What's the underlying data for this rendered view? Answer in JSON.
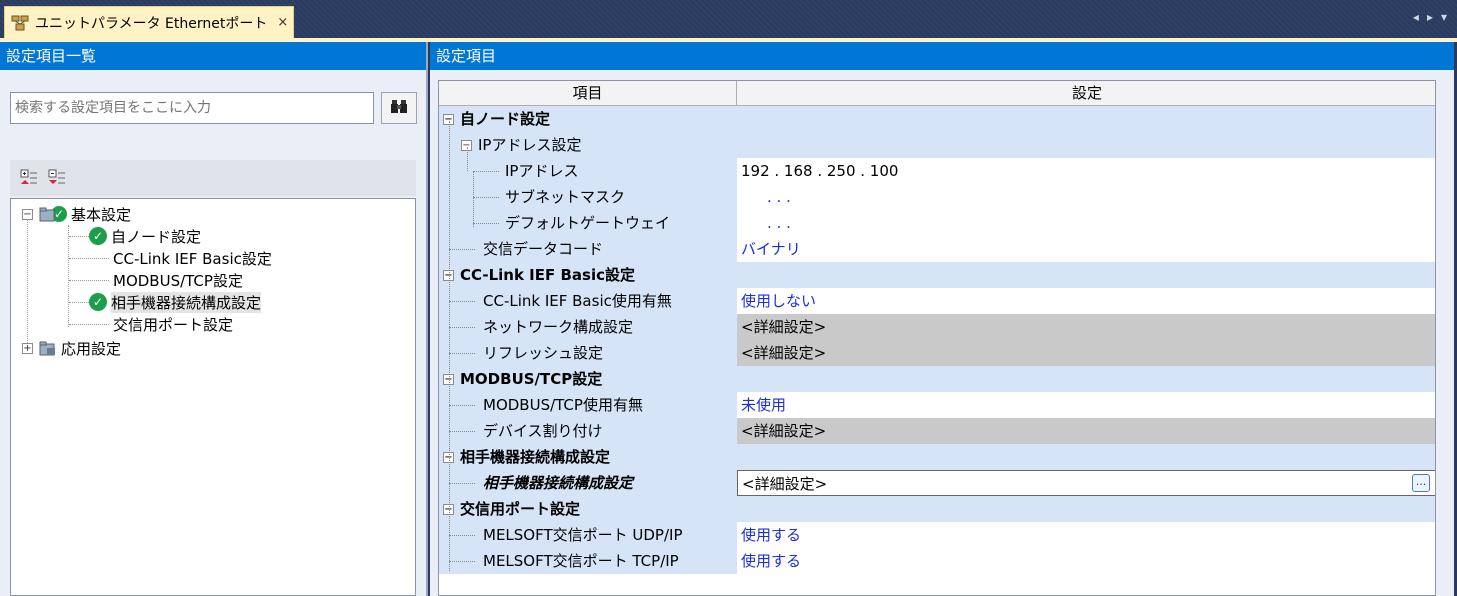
{
  "tab": {
    "title": "ユニットパラメータ Ethernetポート",
    "close": "×"
  },
  "tab_nav": {
    "prev": "◂",
    "next": "▸",
    "menu": "▾"
  },
  "left_panel": {
    "header": "設定項目一覧",
    "search_placeholder": "検索する設定項目をここに入力",
    "tree": [
      {
        "label": "基本設定",
        "expander": "−"
      },
      {
        "label": "自ノード設定"
      },
      {
        "label": "CC-Link IEF Basic設定"
      },
      {
        "label": "MODBUS/TCP設定"
      },
      {
        "label": "相手機器接続構成設定"
      },
      {
        "label": "交信用ポート設定"
      },
      {
        "label": "応用設定",
        "expander": "+"
      }
    ]
  },
  "right_panel": {
    "header": "設定項目",
    "col_item": "項目",
    "col_setting": "設定",
    "rows": [
      {
        "item": "自ノード設定",
        "value": ""
      },
      {
        "item": "IPアドレス設定",
        "value": ""
      },
      {
        "item": "IPアドレス",
        "value": "192 . 168 . 250 . 100"
      },
      {
        "item": "サブネットマスク",
        "value": ".       .       ."
      },
      {
        "item": "デフォルトゲートウェイ",
        "value": ".       .       ."
      },
      {
        "item": "交信データコード",
        "value": "バイナリ"
      },
      {
        "item": "CC-Link IEF Basic設定",
        "value": ""
      },
      {
        "item": "CC-Link IEF Basic使用有無",
        "value": "使用しない"
      },
      {
        "item": "ネットワーク構成設定",
        "value": "<詳細設定>"
      },
      {
        "item": "リフレッシュ設定",
        "value": "<詳細設定>"
      },
      {
        "item": "MODBUS/TCP設定",
        "value": ""
      },
      {
        "item": "MODBUS/TCP使用有無",
        "value": "未使用"
      },
      {
        "item": "デバイス割り付け",
        "value": "<詳細設定>"
      },
      {
        "item": "相手機器接続構成設定",
        "value": ""
      },
      {
        "item": "相手機器接続構成設定",
        "value": "<詳細設定>",
        "button": "..."
      },
      {
        "item": "交信用ポート設定",
        "value": ""
      },
      {
        "item": "MELSOFT交信ポート UDP/IP",
        "value": "使用する"
      },
      {
        "item": "MELSOFT交信ポート TCP/IP",
        "value": "使用する"
      }
    ]
  },
  "colors": {
    "header_blue": "#0077d4",
    "group_bg": "#d5e4f7",
    "value_blue": "#1a2ee0",
    "detail_gray": "#c9c9c9",
    "tab_bg": "#fff2c4",
    "check_green": "#1d9e4a"
  },
  "icons": {
    "tab": "network-port-icon",
    "search": "binoculars-icon",
    "expand_all": "expand-all-icon",
    "collapse_all": "collapse-all-icon",
    "done": "check-icon",
    "folder": "folder-icon"
  }
}
